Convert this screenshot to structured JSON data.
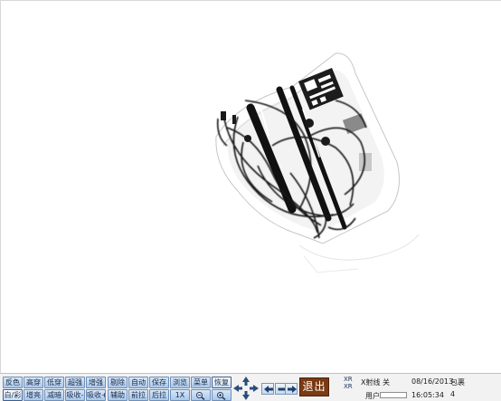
{
  "toolbar": {
    "row1": [
      "反色",
      "高穿",
      "低穿",
      "超强",
      "增强",
      "剔除",
      "自动",
      "保存",
      "浏览",
      "菜单",
      "恢复"
    ],
    "row2": [
      "白/彩",
      "增亮",
      "减暗",
      "吸收-",
      "吸收+",
      "辅助",
      "前拉",
      "后拉",
      "1X"
    ]
  },
  "exit": {
    "label": "退出"
  },
  "status": {
    "ray_label": "X射线 关",
    "date": "08/16/2013",
    "bag_label": "包裹",
    "user_label": "用户",
    "time": "16:05:34",
    "bag_count": "4",
    "ray_icon_top": "XR",
    "ray_icon_bottom": "XR"
  }
}
